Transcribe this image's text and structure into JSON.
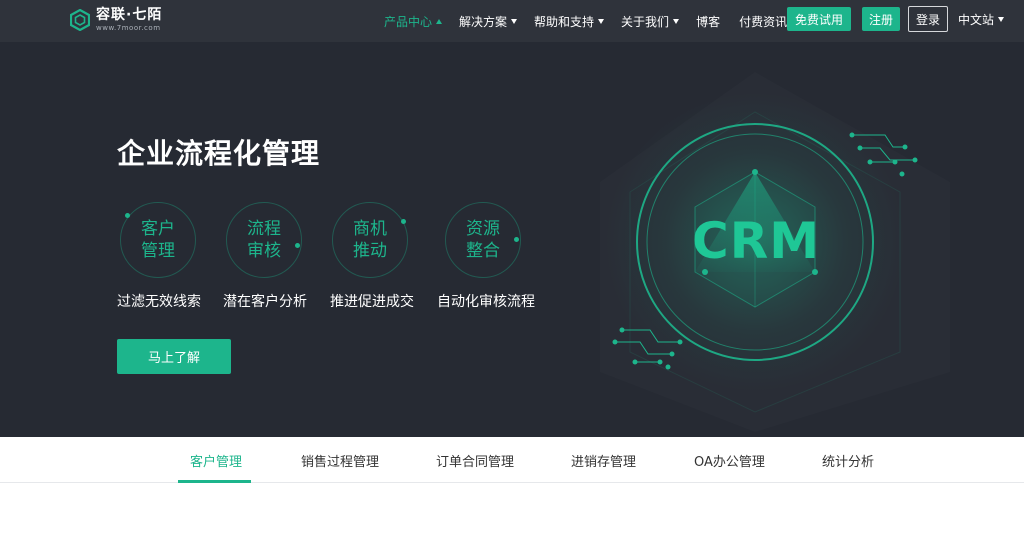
{
  "brand": {
    "name": "容联·七陌",
    "url_text": "www.7moor.com",
    "accent_color": "#1db58c",
    "header_bg": "#2f333b",
    "hero_bg": "#262a33"
  },
  "nav": {
    "items": [
      {
        "label": "产品中心",
        "active": true,
        "caret": "up"
      },
      {
        "label": "解决方案",
        "active": false,
        "caret": "down"
      },
      {
        "label": "帮助和支持",
        "active": false,
        "caret": "down"
      },
      {
        "label": "关于我们",
        "active": false,
        "caret": "down"
      },
      {
        "label": "博客",
        "active": false
      },
      {
        "label": "付费资讯",
        "active": false
      }
    ],
    "trial_label": "免费试用",
    "register_label": "注册",
    "login_label": "登录",
    "language_label": "中文站"
  },
  "hero": {
    "title": "企业流程化管理",
    "features": [
      {
        "line1": "客户",
        "line2": "管理"
      },
      {
        "line1": "流程",
        "line2": "审核"
      },
      {
        "line1": "商机",
        "line2": "推动"
      },
      {
        "line1": "资源",
        "line2": "整合"
      }
    ],
    "descriptions": [
      "过滤无效线索",
      "潜在客户分析",
      "推进促进成交",
      "自动化审核流程"
    ],
    "cta_label": "马上了解",
    "graphic_label": "CRM"
  },
  "tabs": {
    "items": [
      "客户管理",
      "销售过程管理",
      "订单合同管理",
      "进销存管理",
      "OA办公管理",
      "统计分析"
    ],
    "active_index": 0
  },
  "icons": {
    "logo": "hexagon-logo-icon",
    "caret": "caret-down-icon"
  }
}
